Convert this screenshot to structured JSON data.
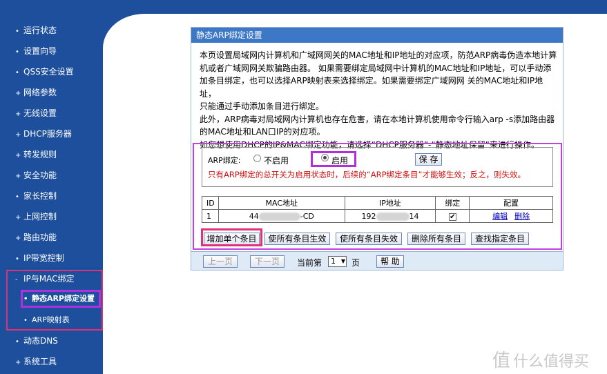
{
  "nav": {
    "items": [
      {
        "label": "运行状态",
        "bullet": "•"
      },
      {
        "label": "设置向导",
        "bullet": "•"
      },
      {
        "label": "QSS安全设置",
        "bullet": "•"
      },
      {
        "label": "网络参数",
        "bullet": "+"
      },
      {
        "label": "无线设置",
        "bullet": "+"
      },
      {
        "label": "DHCP服务器",
        "bullet": "+"
      },
      {
        "label": "转发规则",
        "bullet": "+"
      },
      {
        "label": "安全功能",
        "bullet": "+"
      },
      {
        "label": "家长控制",
        "bullet": "•"
      },
      {
        "label": "上网控制",
        "bullet": "+"
      },
      {
        "label": "路由功能",
        "bullet": "+"
      },
      {
        "label": "IP带宽控制",
        "bullet": "•"
      },
      {
        "label": "IP与MAC绑定",
        "bullet": "-"
      },
      {
        "label": "静态ARP绑定设置",
        "bullet": "•"
      },
      {
        "label": "ARP映射表",
        "bullet": "•"
      },
      {
        "label": "动态DNS",
        "bullet": "•"
      },
      {
        "label": "系统工具",
        "bullet": "+"
      }
    ]
  },
  "panel": {
    "title": "静态ARP绑定设置",
    "description": [
      "本页设置局域网内计算机和广域网网关的MAC地址和IP地址的对应项，防范ARP病毒伪造本地计算",
      "机或者广域网网关欺骗路由器。 如果需要绑定局域网中计算机的MAC地址和IP地址，可以手动添",
      "加条目绑定，也可以选择ARP映射表来选择绑定。如果需要绑定广域网网 关的MAC地址和IP地址，",
      "只能通过手动添加条目进行绑定。",
      "此外，ARP病毒对局域网内计算机也存在危害，请在本地计算机使用命令行输入arp -s添加路由器",
      "的MAC地址和LAN口IP的对应项。",
      "如您想使用DHCP的IP&MAC绑定功能，请选择“DHCP服务器”-“静态地址保留”来进行操作。"
    ],
    "arp_label": "ARP绑定:",
    "radio_disable": "不启用",
    "radio_enable": "启用",
    "save_label": "保 存",
    "warning": "只有ARP绑定的总开关为启用状态时，后续的“ARP绑定条目”才能够生效；反之，则失效。",
    "table": {
      "headers": [
        "ID",
        "MAC地址",
        "IP地址",
        "绑定",
        "配置"
      ],
      "rows": [
        {
          "id": "1",
          "mac_prefix": "44",
          "mac_suffix": "-CD",
          "ip_prefix": "192",
          "ip_suffix": "14",
          "bound": "✔",
          "edit": "编辑",
          "delete": "删除"
        }
      ]
    },
    "actions": {
      "add": "增加单个条目",
      "enable_all": "使所有条目生效",
      "disable_all": "使所有条目失效",
      "delete_all": "删除所有条目",
      "find": "查找指定条目"
    },
    "pager": {
      "prev": "上一页",
      "next": "下一页",
      "current_label": "当前第",
      "page_value": "1",
      "page_unit": "页",
      "help": "帮 助"
    }
  },
  "watermark": {
    "logo": "值",
    "text": "什么值得买"
  },
  "colors": {
    "nav_bg": "#1d4f9c",
    "title_bg": "#3d78c7",
    "highlight_purple": "#b030e0",
    "highlight_pink": "#e0307a",
    "warning": "#d01010"
  }
}
